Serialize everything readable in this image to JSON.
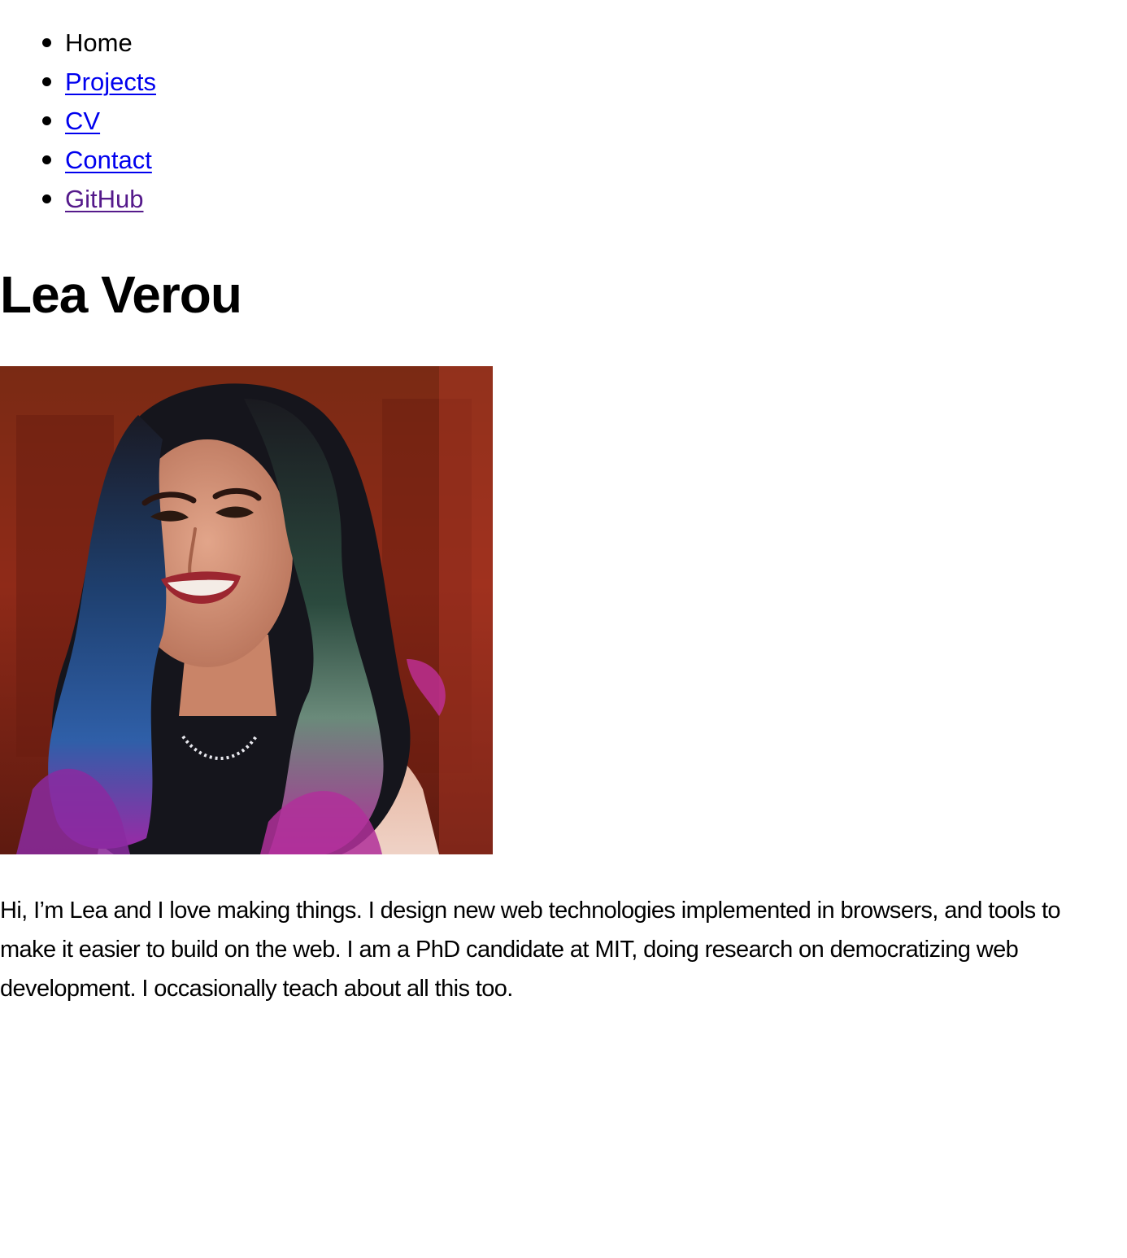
{
  "nav": {
    "items": [
      {
        "label": "Home",
        "state": "current"
      },
      {
        "label": "Projects",
        "state": "link"
      },
      {
        "label": "CV",
        "state": "link"
      },
      {
        "label": "Contact",
        "state": "link"
      },
      {
        "label": "GitHub",
        "state": "visited"
      }
    ]
  },
  "page": {
    "title": "Lea Verou"
  },
  "profile": {
    "photo": "portrait-photo"
  },
  "intro": {
    "text": "Hi, I’m Lea and I love making things. I design new web technologies implemented in browsers, and tools to make it easier to build on the web. I am a PhD candidate at MIT, doing research on democratizing web development. I occasionally teach about all this too."
  },
  "colors": {
    "link": "#0000ee",
    "visited": "#551a8b",
    "text": "#000000",
    "background": "#ffffff"
  }
}
